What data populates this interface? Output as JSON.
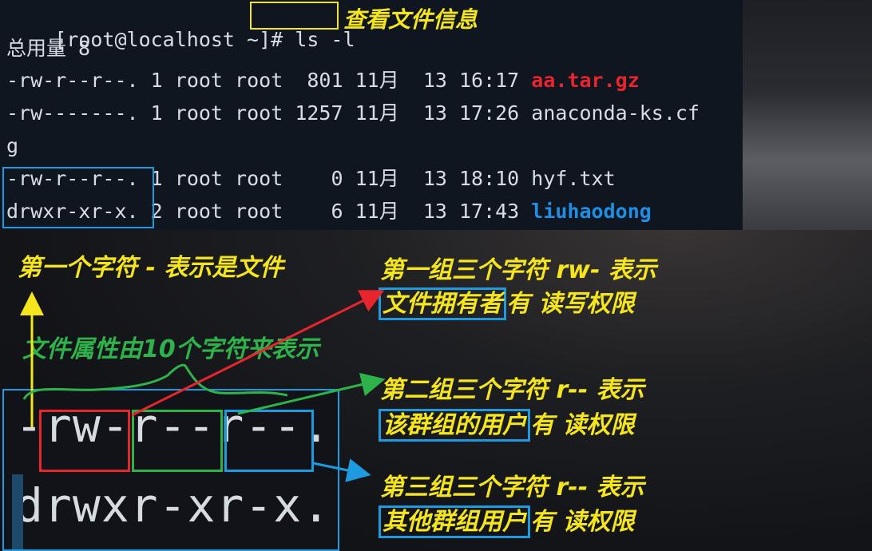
{
  "terminal": {
    "prompt": "[root@localhost ~]#",
    "command": "ls -l",
    "command_note": "查看文件信息",
    "total": "总用量 8",
    "rows": [
      {
        "perm": "-rw-r--r--.",
        "links": "1",
        "owner": "root",
        "group": "root",
        "size": " 801",
        "date": "11月  13 16:17",
        "name": "aa.tar.gz"
      },
      {
        "perm": "-rw-------.",
        "links": "1",
        "owner": "root",
        "group": "root",
        "size": "1257",
        "date": "11月  13 17:26",
        "name": "anaconda-ks.cf",
        "name_wrap": "g"
      },
      {
        "perm": "-rw-r--r--.",
        "links": "1",
        "owner": "root",
        "group": "root",
        "size": "   0",
        "date": "11月  13 18:10",
        "name": "hyf.txt"
      },
      {
        "perm": "drwxr-xr-x.",
        "links": "2",
        "owner": "root",
        "group": "root",
        "size": "   6",
        "date": "11月  13 17:43",
        "name": "liuhaodong"
      }
    ]
  },
  "annotations": {
    "first_char": "第一个字符 - 表示是文件",
    "attr_desc": "文件属性由10个字符来表示",
    "group1_title": "第一组三个字符 rw- 表示",
    "group1_boxed": "文件拥有者",
    "group1_rest": "有 读写权限",
    "group2_title": "第二组三个字符 r-- 表示",
    "group2_boxed": "该群组的用户",
    "group2_rest": "有 读权限",
    "group3_title": "第三组三个字符 r-- 表示",
    "group3_boxed": "其他群组用户",
    "group3_rest": "有 读权限"
  },
  "zoom": {
    "line1": "-rw-r--r--.",
    "line2": "drwxr-xr-x."
  },
  "colors": {
    "yellow": "#f5e51c",
    "red": "#e8242c",
    "green": "#2db34a",
    "blue": "#1e9be0"
  }
}
